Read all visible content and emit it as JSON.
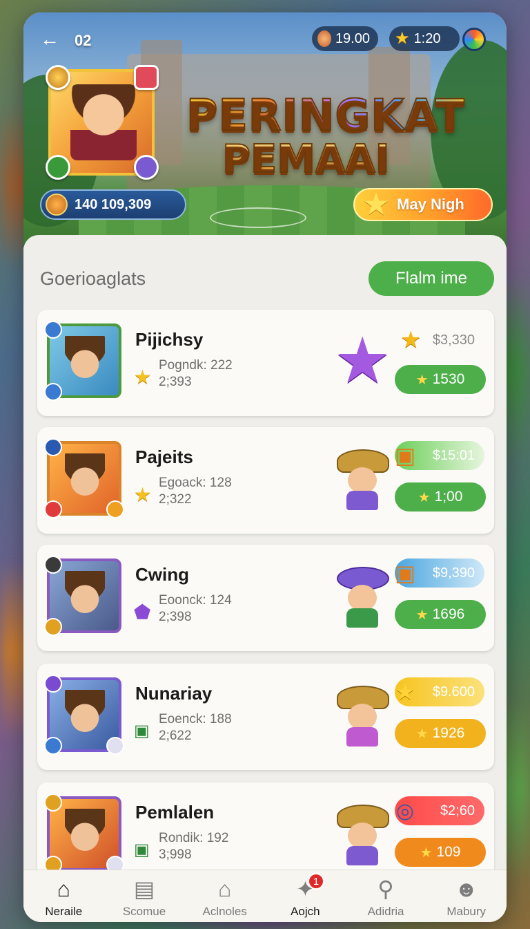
{
  "header": {
    "back_icon": "arrow-left-icon",
    "level_label": "02",
    "coins": "19.00",
    "stars": "1:20",
    "title_line1": "PERINGKAT",
    "title_line2": "PEMAAI",
    "player_score": "140 109,309",
    "night_button_label": "May Nigh"
  },
  "panel": {
    "section_title": "Goerioaglats",
    "filter_button_label": "Flalm ime"
  },
  "colors": {
    "accent_green": "#4daf4a",
    "accent_yellow": "#f1b21e",
    "accent_orange": "#f08a1c",
    "accent_red": "#ff4a4a",
    "accent_blue": "#4aa6e0"
  },
  "leaderboard": [
    {
      "name": "Pijichsy",
      "stat1": "Pogndk: 222",
      "stat2": "2;393",
      "stat_icon": "star-icon",
      "character": "star-creature-icon",
      "money": "$3,330",
      "money_icon": "star-icon",
      "points": "1530",
      "points_color": "green"
    },
    {
      "name": "Pajeits",
      "stat1": "Egoack: 128",
      "stat2": "2;322",
      "stat_icon": "star-icon",
      "character": "explorer-character-icon",
      "money": "$15:01",
      "money_icon": "chest-icon",
      "points": "1;00",
      "points_color": "green"
    },
    {
      "name": "Cwing",
      "stat1": "Eoonck: 124",
      "stat2": "2;398",
      "stat_icon": "gem-icon",
      "character": "elf-character-icon",
      "money": "$9,390",
      "money_icon": "chest-icon",
      "points": "1696",
      "points_color": "green"
    },
    {
      "name": "Nunariay",
      "stat1": "Eoenck: 188",
      "stat2": "2;622",
      "stat_icon": "box-icon",
      "character": "explorer-character-icon",
      "money": "$9.600",
      "money_icon": "star-icon",
      "points": "1926",
      "points_color": "yellow"
    },
    {
      "name": "Pemlalen",
      "stat1": "Rondik: 192",
      "stat2": "3;998",
      "stat_icon": "box-icon",
      "character": "explorer-character-icon",
      "money": "$2;60",
      "money_icon": "swirl-icon",
      "points": "109",
      "points_color": "orange"
    }
  ],
  "nav": {
    "items": [
      {
        "label": "Neraile",
        "icon": "home-icon"
      },
      {
        "label": "Scomue",
        "icon": "document-icon"
      },
      {
        "label": "Aclnoles",
        "icon": "house-icon"
      },
      {
        "label": "Aojch",
        "icon": "badge-icon",
        "badge": "1"
      },
      {
        "label": "Adidria",
        "icon": "search-icon"
      },
      {
        "label": "Mabury",
        "icon": "user-icon"
      }
    ]
  }
}
